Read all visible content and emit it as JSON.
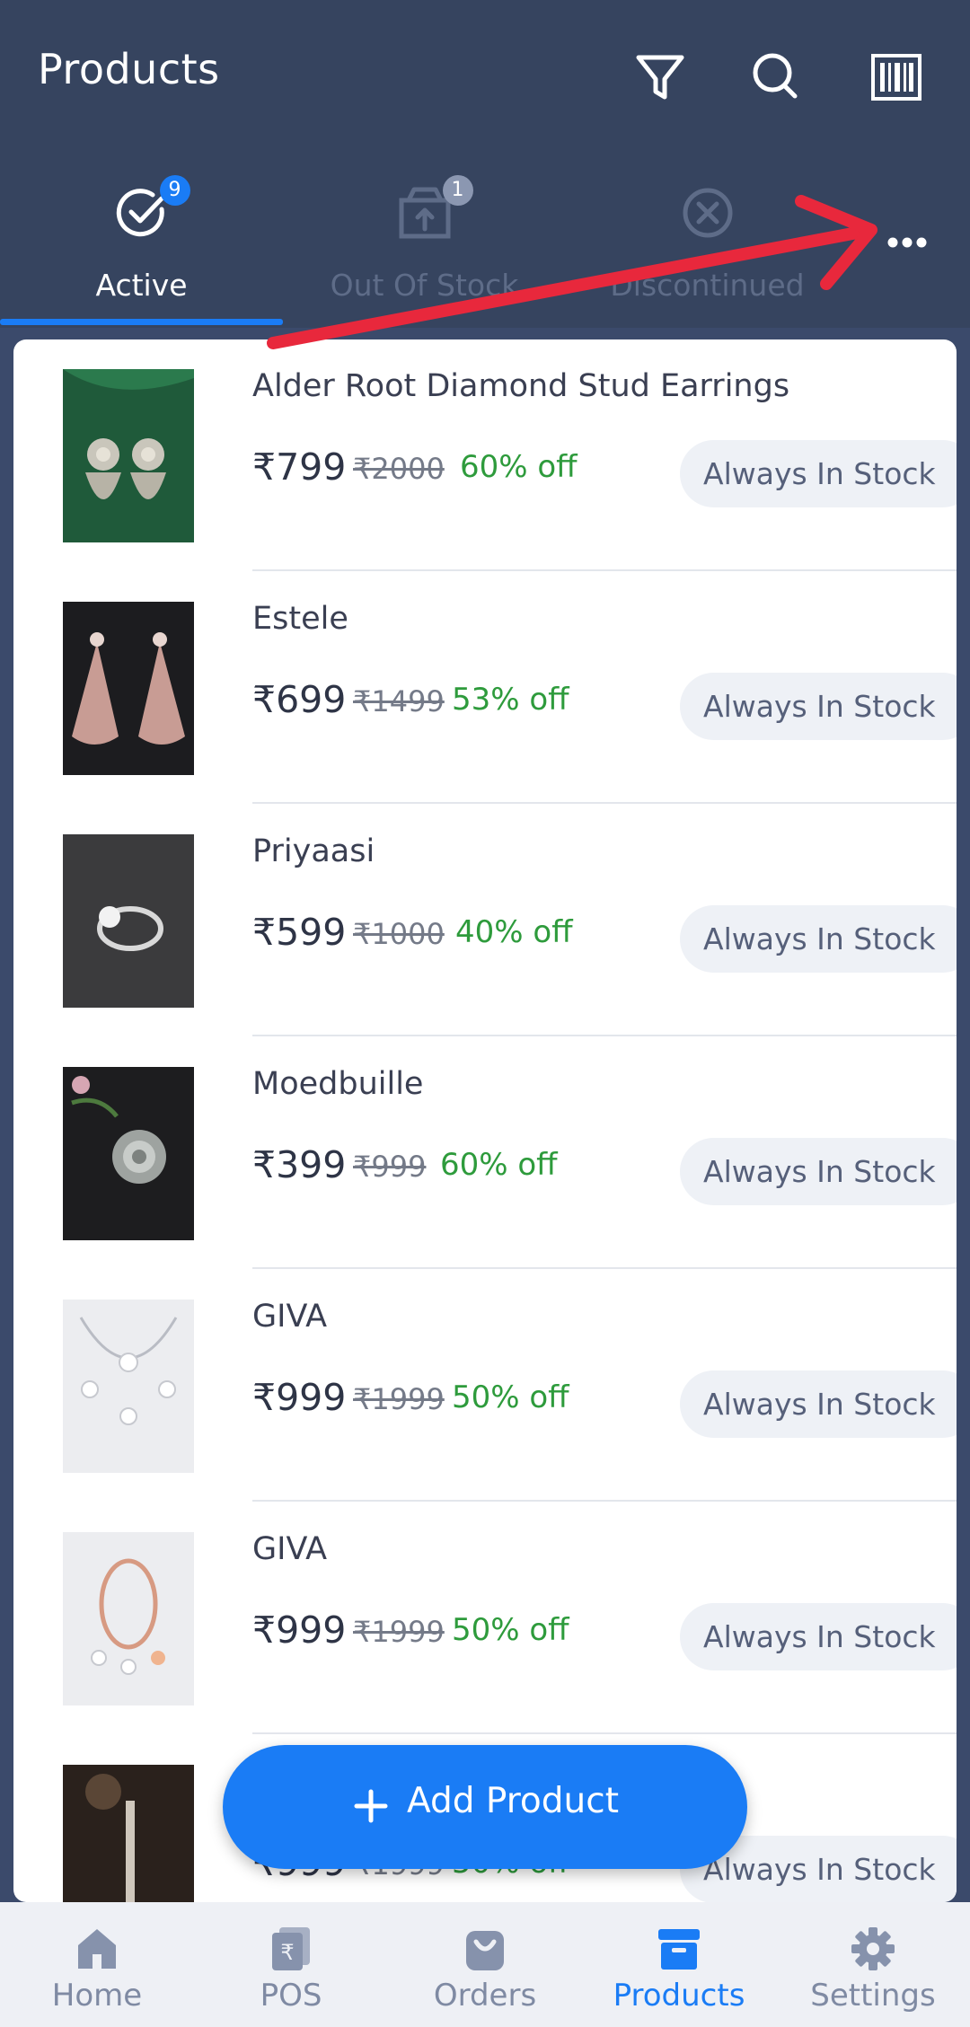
{
  "header": {
    "title": "Products",
    "icons": [
      "filter-icon",
      "search-icon",
      "barcode-icon"
    ]
  },
  "tabs": [
    {
      "label": "Active",
      "badge": "9",
      "icon": "check-circle-icon",
      "active": true
    },
    {
      "label": "Out Of Stock",
      "badge": "1",
      "icon": "box-upload-icon",
      "active": false
    },
    {
      "label": "Discontinued",
      "badge": "",
      "icon": "x-circle-icon",
      "active": false
    }
  ],
  "more_icon": "more-horizontal-icon",
  "products": [
    {
      "name": "Alder Root Diamond Stud Earrings",
      "price": "₹799",
      "mrp": "₹2000",
      "discount": "60% off",
      "stock": "Always In Stock"
    },
    {
      "name": "Estele",
      "price": "₹699",
      "mrp": "₹1499",
      "discount": "53% off",
      "stock": "Always In Stock"
    },
    {
      "name": "Priyaasi",
      "price": "₹599",
      "mrp": "₹1000",
      "discount": "40% off",
      "stock": "Always In Stock"
    },
    {
      "name": "Moedbuille",
      "price": "₹399",
      "mrp": "₹999",
      "discount": "60% off",
      "stock": "Always In Stock"
    },
    {
      "name": "GIVA",
      "price": "₹999",
      "mrp": "₹1999",
      "discount": "50% off",
      "stock": "Always In Stock"
    },
    {
      "name": "GIVA",
      "price": "₹999",
      "mrp": "₹1999",
      "discount": "50% off",
      "stock": "Always In Stock"
    },
    {
      "name": "",
      "price": "₹999",
      "mrp": "₹1999",
      "discount": "50% off",
      "stock": "Always In Stock"
    }
  ],
  "fab": {
    "label": "Add Product"
  },
  "bottom_nav": [
    {
      "label": "Home",
      "icon": "home-icon",
      "active": false
    },
    {
      "label": "POS",
      "icon": "pos-receipt-icon",
      "active": false
    },
    {
      "label": "Orders",
      "icon": "shopping-bag-icon",
      "active": false
    },
    {
      "label": "Products",
      "icon": "archive-box-icon",
      "active": true
    },
    {
      "label": "Settings",
      "icon": "gear-icon",
      "active": false
    }
  ],
  "colors": {
    "header_bg": "#36445f",
    "accent": "#1a7cf5",
    "discount_green": "#2e9b3c",
    "annotation_arrow": "#e8283c"
  }
}
